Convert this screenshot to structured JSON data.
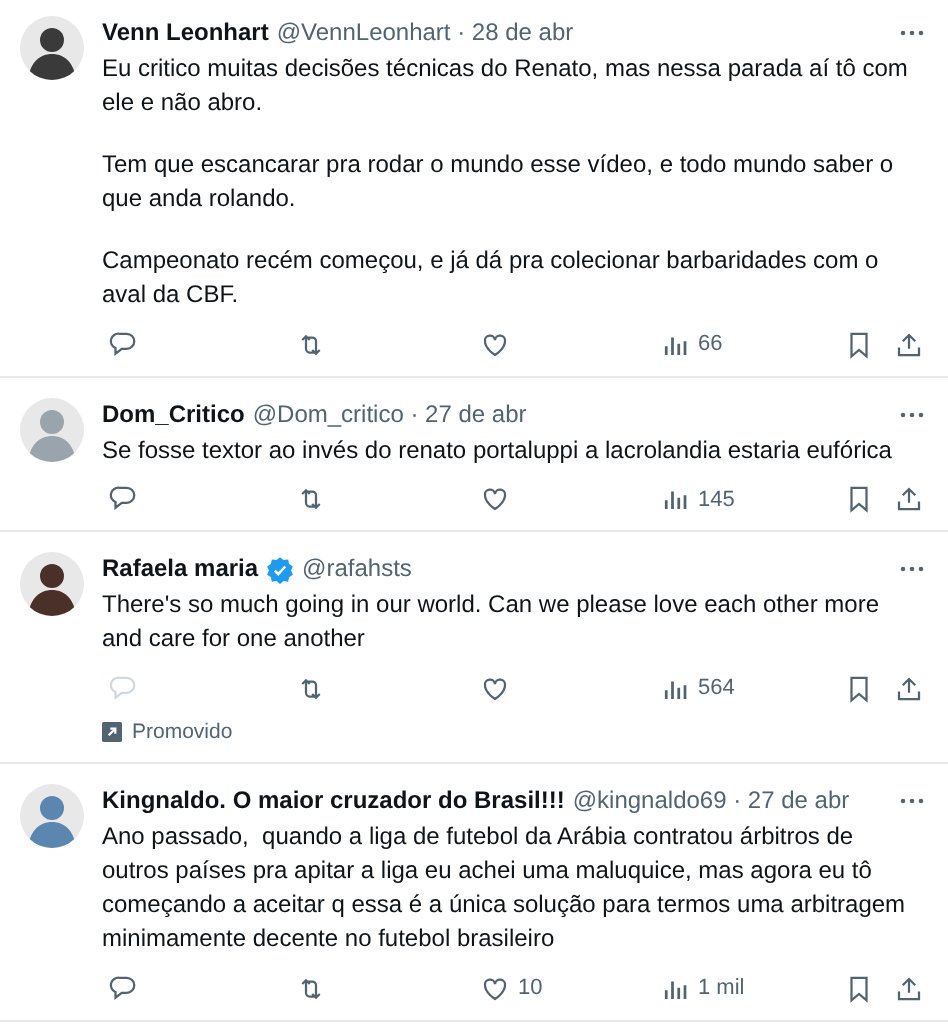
{
  "tweets": [
    {
      "name": "Venn Leonhart",
      "verified": false,
      "handle": "@VennLeonhart · 28 de abr",
      "paragraphs": [
        "Eu critico muitas decisões técnicas do Renato, mas nessa parada aí tô com ele e não abro.",
        "Tem que escancarar pra rodar o mundo esse vídeo, e todo mundo saber o que anda rolando.",
        "Campeonato recém começou, e já dá pra colecionar barbaridades com o aval da CBF."
      ],
      "reply_disabled": false,
      "views": "66"
    },
    {
      "name": "Dom_Critico",
      "verified": false,
      "handle": "@Dom_critico · 27 de abr",
      "paragraphs": [
        "Se fosse textor ao invés do renato portaluppi a lacrolandia estaria eufórica"
      ],
      "reply_disabled": false,
      "views": "145"
    },
    {
      "name": "Rafaela maria",
      "verified": true,
      "handle": "@rafahsts",
      "paragraphs": [
        "There's so much going in our world. Can we please love each other more and care for one another"
      ],
      "reply_disabled": true,
      "views": "564",
      "promoted": "Promovido"
    },
    {
      "name": "Kingnaldo. O maior cruzador do Brasil!!!",
      "verified": false,
      "handle": "@kingnaldo69 · 27 de abr",
      "paragraphs": [
        "Ano passado,  quando a liga de futebol da Arábia contratou árbitros de outros países pra apitar a liga eu achei uma maluquice, mas agora eu tô começando a aceitar q essa é a única solução para termos uma arbitragem minimamente decente no futebol brasileiro"
      ],
      "reply_disabled": false,
      "likes": "10",
      "views": "1 mil"
    }
  ]
}
